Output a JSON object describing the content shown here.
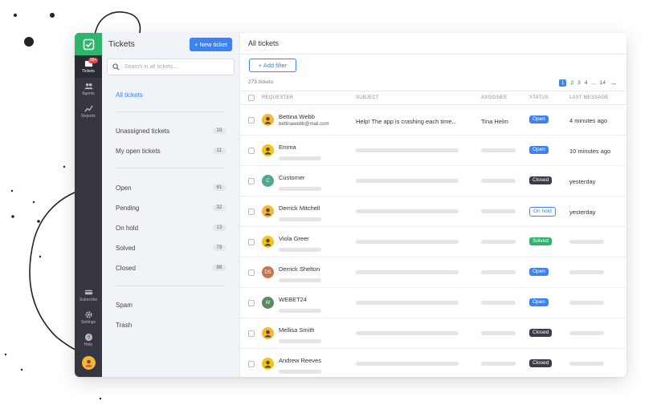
{
  "colors": {
    "accent": "#3d82f2",
    "brand": "#2db56c",
    "rail": "#353640",
    "open": "#3d82f2",
    "closed": "#3b3d46",
    "solved": "#2db56c"
  },
  "rail": {
    "badge": "99+",
    "items": [
      {
        "label": "Tickets",
        "icon": "inbox-icon"
      },
      {
        "label": "Agents",
        "icon": "users-icon"
      },
      {
        "label": "Reports",
        "icon": "chart-icon"
      }
    ],
    "bottom": [
      {
        "label": "Subscribe",
        "icon": "card-icon"
      },
      {
        "label": "Settings",
        "icon": "gear-icon"
      },
      {
        "label": "Help",
        "icon": "help-icon"
      }
    ]
  },
  "panel": {
    "title": "Tickets",
    "new_ticket": "+ New ticket",
    "search_placeholder": "Search in all tickets...",
    "all": "All tickets",
    "groups": [
      {
        "label": "Unassigned tickets",
        "count": "19"
      },
      {
        "label": "My open tickets",
        "count": "11"
      },
      {
        "label": "Open",
        "count": "61"
      },
      {
        "label": "Pending",
        "count": "32"
      },
      {
        "label": "On hold",
        "count": "13"
      },
      {
        "label": "Solved",
        "count": "79"
      },
      {
        "label": "Closed",
        "count": "88"
      },
      {
        "label": "Spam"
      },
      {
        "label": "Trash"
      }
    ]
  },
  "main": {
    "title": "All tickets",
    "add_filter": "+ Add filter",
    "ticket_count": "273 tickets",
    "pages": [
      "1",
      "2",
      "3",
      "4",
      "...",
      "14"
    ],
    "next": "→",
    "columns": [
      "REQUESTER",
      "SUBJECT",
      "ASSIGNEE",
      "STATUS",
      "LAST MESSAGE"
    ],
    "rows": [
      {
        "name": "Bettina Webb",
        "email": "bettinawebb@mail.com",
        "subject": "Help! The app is crashing each time...",
        "assignee": "Tina Helm",
        "status": "Open",
        "last": "4 minutes ago",
        "avatar_color": "#f3b73a",
        "initials": ""
      },
      {
        "name": "Emma",
        "email": "",
        "subject": "",
        "assignee": "",
        "status": "Open",
        "last": "10 minutes ago",
        "avatar_color": "#f0c419",
        "initials": ""
      },
      {
        "name": "Customer",
        "email": "",
        "subject": "",
        "assignee": "",
        "status": "Closed",
        "last": "yesterday",
        "avatar_color": "#4fa88f",
        "initials": "C"
      },
      {
        "name": "Derrick Mitchell",
        "email": "",
        "subject": "",
        "assignee": "",
        "status": "On hold",
        "last": "yesterday",
        "avatar_color": "#f3b73a",
        "initials": ""
      },
      {
        "name": "Viola Greer",
        "email": "",
        "subject": "",
        "assignee": "",
        "status": "Solved",
        "last": "",
        "avatar_color": "#f0c419",
        "initials": ""
      },
      {
        "name": "Derrick Shelton",
        "email": "",
        "subject": "",
        "assignee": "",
        "status": "Open",
        "last": "",
        "avatar_color": "#c8734f",
        "initials": "DS"
      },
      {
        "name": "WEBET24",
        "email": "",
        "subject": "",
        "assignee": "",
        "status": "Open",
        "last": "",
        "avatar_color": "#5a8a5e",
        "initials": "W"
      },
      {
        "name": "Mellisa Smith",
        "email": "",
        "subject": "",
        "assignee": "",
        "status": "Closed",
        "last": "",
        "avatar_color": "#f3b73a",
        "initials": ""
      },
      {
        "name": "Andrew Reeves",
        "email": "",
        "subject": "",
        "assignee": "",
        "status": "Closed",
        "last": "",
        "avatar_color": "#f0c419",
        "initials": ""
      }
    ]
  }
}
